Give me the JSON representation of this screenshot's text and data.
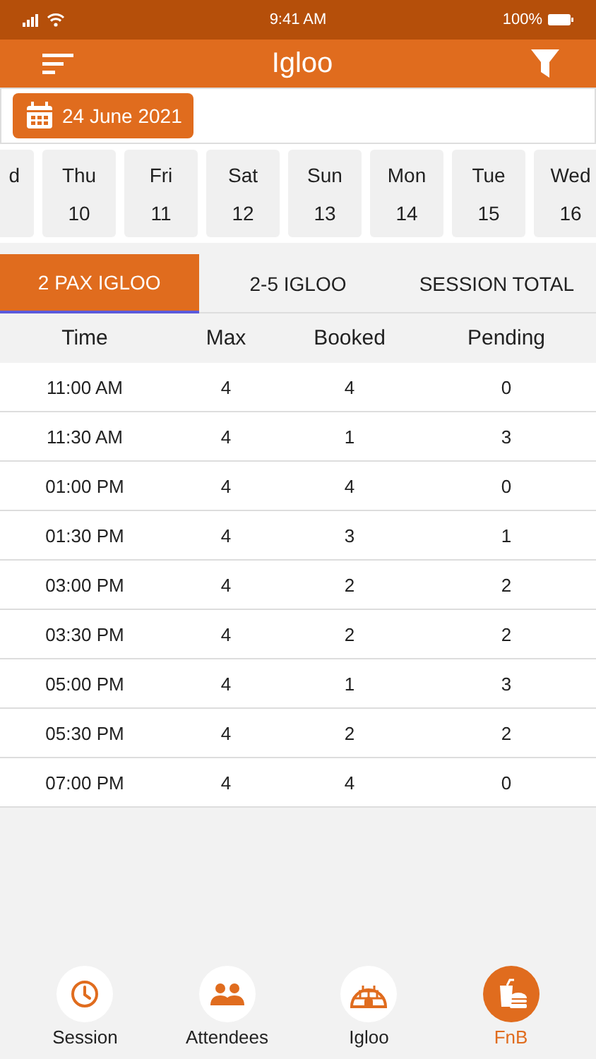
{
  "status_bar": {
    "time": "9:41 AM",
    "battery": "100%"
  },
  "app_bar": {
    "title": "Igloo"
  },
  "date_button": {
    "label": "24 June 2021"
  },
  "days": [
    {
      "name": "d"
    },
    {
      "name": "Thu",
      "number": "10"
    },
    {
      "name": "Fri",
      "number": "11"
    },
    {
      "name": "Sat",
      "number": "12"
    },
    {
      "name": "Sun",
      "number": "13"
    },
    {
      "name": "Mon",
      "number": "14"
    },
    {
      "name": "Tue",
      "number": "15"
    },
    {
      "name": "Wed",
      "number": "16"
    }
  ],
  "tabs": [
    {
      "label": "2 PAX IGLOO",
      "selected": true
    },
    {
      "label": "2-5 IGLOO",
      "selected": false
    },
    {
      "label": "SESSION TOTAL",
      "selected": false
    }
  ],
  "table": {
    "columns": [
      "Time",
      "Max",
      "Booked",
      "Pending"
    ],
    "rows": [
      [
        "11:00 AM",
        "4",
        "4",
        "0"
      ],
      [
        "11:30 AM",
        "4",
        "1",
        "3"
      ],
      [
        "01:00 PM",
        "4",
        "4",
        "0"
      ],
      [
        "01:30 PM",
        "4",
        "3",
        "1"
      ],
      [
        "03:00 PM",
        "4",
        "2",
        "2"
      ],
      [
        "03:30 PM",
        "4",
        "2",
        "2"
      ],
      [
        "05:00 PM",
        "4",
        "1",
        "3"
      ],
      [
        "05:30 PM",
        "4",
        "2",
        "2"
      ],
      [
        "07:00 PM",
        "4",
        "4",
        "0"
      ]
    ]
  },
  "bottom_nav": [
    {
      "label": "Session",
      "kind": "clock",
      "selected": false
    },
    {
      "label": "Attendees",
      "kind": "people",
      "selected": false
    },
    {
      "label": "Igloo",
      "kind": "igloo",
      "selected": false
    },
    {
      "label": "FnB",
      "kind": "food",
      "selected": true
    }
  ]
}
